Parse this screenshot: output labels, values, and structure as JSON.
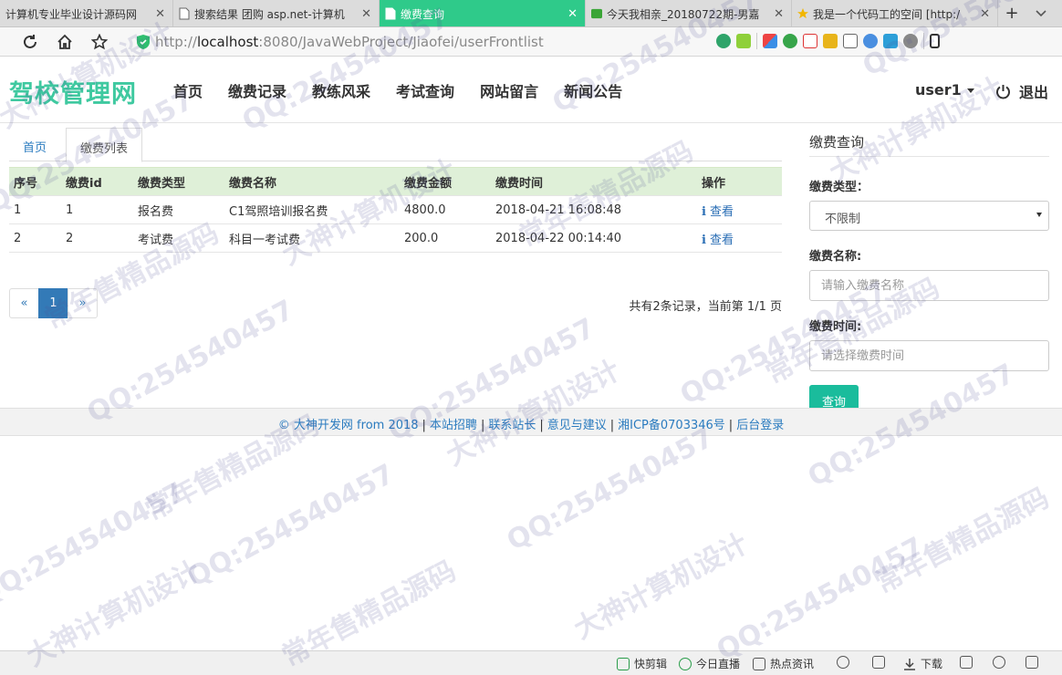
{
  "browser": {
    "tabs": [
      {
        "title": "计算机专业毕业设计源码网",
        "active": false
      },
      {
        "title": "搜索结果 团购 asp.net-计算机",
        "active": false
      },
      {
        "title": "缴费查询",
        "active": true
      },
      {
        "title": "今天我相亲_20180722期-男嘉",
        "active": false
      },
      {
        "title": "我是一个代码工的空间 [http:/",
        "active": false
      }
    ],
    "close_glyph": "✕",
    "new_tab_glyph": "+",
    "url_prefix": "http://",
    "url_host": "localhost",
    "url_rest": ":8080/JavaWebProject/Jiaofei/userFrontlist"
  },
  "site": {
    "brand": "驾校管理网",
    "menu": [
      "首页",
      "缴费记录",
      "教练风采",
      "考试查询",
      "网站留言",
      "新闻公告"
    ],
    "user": "user1",
    "logout": "退出"
  },
  "content_tabs": [
    "首页",
    "缴费列表"
  ],
  "table": {
    "headers": [
      "序号",
      "缴费id",
      "缴费类型",
      "缴费名称",
      "缴费金额",
      "缴费时间",
      "操作"
    ],
    "rows": [
      [
        "1",
        "1",
        "报名费",
        "C1驾照培训报名费",
        "4800.0",
        "2018-04-21 16:08:48",
        "查看"
      ],
      [
        "2",
        "2",
        "考试费",
        "科目一考试费",
        "200.0",
        "2018-04-22 00:14:40",
        "查看"
      ]
    ],
    "action_icon": "i"
  },
  "pagination": {
    "prev": "«",
    "current": "1",
    "next": "»",
    "info": "共有2条记录，当前第 1/1 页"
  },
  "sidebar": {
    "title": "缴费查询",
    "type_label": "缴费类型：",
    "type_value": "不限制",
    "name_label": "缴费名称:",
    "name_placeholder": "请输入缴费名称",
    "time_label": "缴费时间:",
    "time_placeholder": "请选择缴费时间",
    "submit": "查询"
  },
  "footer": {
    "links": [
      "© 大神开发网 from 2018",
      "本站招聘",
      "联系站长",
      "意见与建议",
      "湘ICP备0703346号",
      "后台登录"
    ],
    "separator": "|"
  },
  "statusbar": {
    "items": [
      "快剪辑",
      "今日直播",
      "热点资讯",
      "下载"
    ]
  },
  "watermark": {
    "texts": [
      "QQ:254540457",
      "常年售精品源码",
      "大神计算机设计"
    ]
  },
  "colors": {
    "brand": "#3fc9a0",
    "active_tab": "#2fca8a",
    "table_header": "#dff0d8",
    "link": "#2a7bbf",
    "button": "#1abc9c",
    "pager_active": "#337ab7"
  }
}
